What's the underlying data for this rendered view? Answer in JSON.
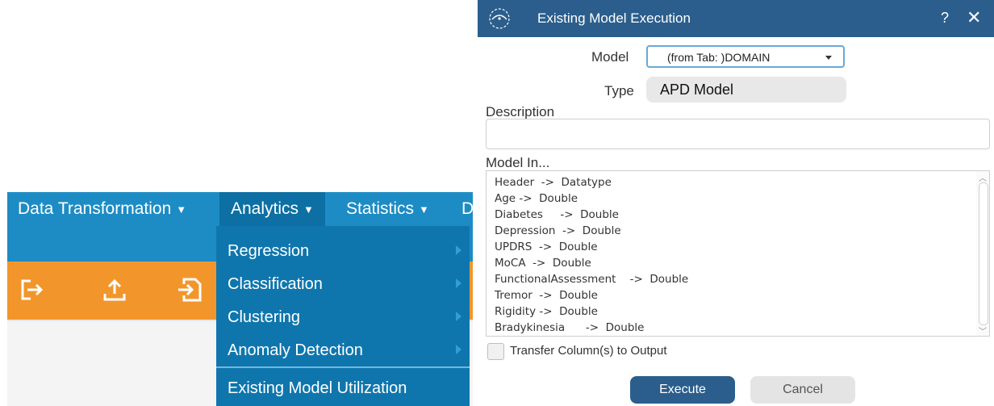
{
  "app": {
    "menu": {
      "items": [
        {
          "label": "Data Transformation"
        },
        {
          "label": "Analytics"
        },
        {
          "label": "Statistics"
        },
        {
          "label": "D"
        }
      ],
      "caret": "▼"
    },
    "toolbar_icons": [
      "exit-icon",
      "upload-icon",
      "import-icon"
    ],
    "analytics_dropdown": {
      "items": [
        {
          "label": "Regression",
          "has_submenu": true
        },
        {
          "label": "Classification",
          "has_submenu": true
        },
        {
          "label": "Clustering",
          "has_submenu": true
        },
        {
          "label": "Anomaly Detection",
          "has_submenu": true
        },
        {
          "label": "Existing Model Utilization",
          "has_submenu": false
        }
      ]
    },
    "colors": {
      "menubar": "#1d8cc4",
      "dropdown": "#0f76ad",
      "toolbar": "#f2962c"
    }
  },
  "dialog": {
    "title": "Existing Model Execution",
    "help": "?",
    "close": "✕",
    "model_label": "Model",
    "model_value": "(from Tab: )DOMAIN",
    "type_label": "Type",
    "type_value": "APD Model",
    "description_label": "Description",
    "description_value": "",
    "model_in_label": "Model In...",
    "model_in_items": [
      "Header  ->  Datatype",
      "Age ->  Double",
      "Diabetes     ->  Double",
      "Depression  ->  Double",
      "UPDRS  ->  Double",
      "MoCA  ->  Double",
      "FunctionalAssessment    ->  Double",
      "Tremor  ->  Double",
      "Rigidity ->  Double",
      "Bradykinesia      ->  Double"
    ],
    "transfer_label": "Transfer Column(s) to Output",
    "transfer_checked": false,
    "execute_label": "Execute",
    "cancel_label": "Cancel",
    "colors": {
      "titlebar": "#2b5e8c",
      "primary": "#2b5e8c",
      "secondary": "#e4e4e4"
    }
  }
}
